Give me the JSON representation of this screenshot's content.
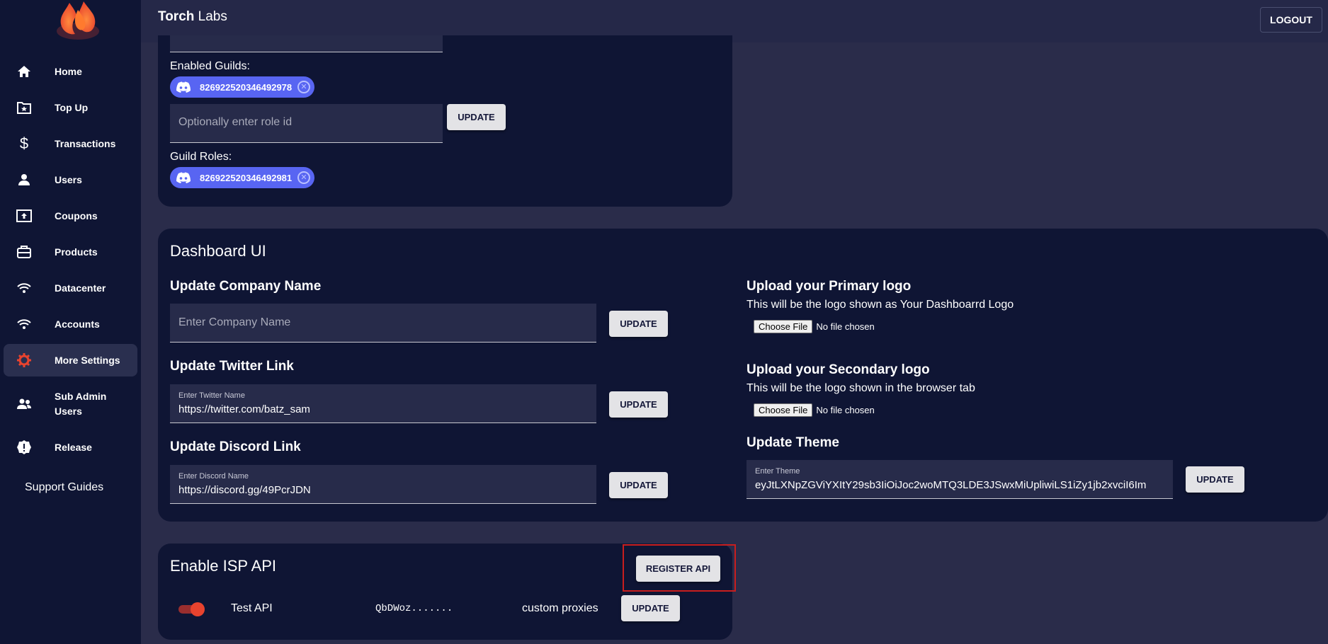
{
  "app": {
    "brand_bold": "Torch",
    "brand_rest": " Labs",
    "logout_label": "LOGOUT"
  },
  "colors": {
    "sidebar_bg": "#0f1534",
    "page_bg": "#2a2c4a",
    "accent": "#e8432e",
    "chip": "#5865f2",
    "highlight": "#c81e1e"
  },
  "sidebar": {
    "items": [
      {
        "label": "Home",
        "icon": "home-icon"
      },
      {
        "label": "Top Up",
        "icon": "folder-star-icon"
      },
      {
        "label": "Transactions",
        "icon": "dollar-icon"
      },
      {
        "label": "Users",
        "icon": "user-icon"
      },
      {
        "label": "Coupons",
        "icon": "upload-box-icon"
      },
      {
        "label": "Products",
        "icon": "briefcase-icon"
      },
      {
        "label": "Datacenter",
        "icon": "wifi-icon"
      },
      {
        "label": "Accounts",
        "icon": "wifi-icon"
      },
      {
        "label": "More Settings",
        "icon": "gear-icon",
        "active": true
      },
      {
        "label": "Sub Admin",
        "label2": "Users",
        "icon": "users-icon"
      },
      {
        "label": "Release",
        "icon": "alert-badge-icon"
      }
    ],
    "support": "Support Guides"
  },
  "guild_card": {
    "enabled_guilds_label": "Enabled Guilds:",
    "enabled_guild_id": "826922520346492978",
    "role_placeholder": "Optionally enter role id",
    "update_label": "UPDATE",
    "guild_roles_label": "Guild Roles:",
    "guild_role_id": "826922520346492981"
  },
  "dashboard_ui": {
    "title": "Dashboard UI",
    "company": {
      "heading": "Update Company Name",
      "placeholder": "Enter Company Name",
      "button": "UPDATE"
    },
    "twitter": {
      "heading": "Update Twitter Link",
      "field_label": "Enter Twitter Name",
      "value": "https://twitter.com/batz_sam",
      "button": "UPDATE"
    },
    "discord": {
      "heading": "Update Discord Link",
      "field_label": "Enter Discord Name",
      "value": "https://discord.gg/49PcrJDN",
      "button": "UPDATE"
    },
    "primary_logo": {
      "heading": "Upload your Primary logo",
      "desc": "This will be the logo shown as Your Dashboarrd Logo",
      "choose": "Choose File",
      "status": "No file chosen"
    },
    "secondary_logo": {
      "heading": "Upload your Secondary logo",
      "desc": "This will be the logo shown in the browser tab",
      "choose": "Choose File",
      "status": "No file chosen"
    },
    "theme": {
      "heading": "Update Theme",
      "field_label": "Enter Theme",
      "value": "eyJtLXNpZGViYXItY29sb3IiOiJoc2woMTQ3LDE3JSwxMiUpliwiLS1iZy1jb2xvciI6Im",
      "button": "UPDATE"
    }
  },
  "isp_api": {
    "title": "Enable ISP API",
    "register_button": "REGISTER API",
    "api_name": "Test API",
    "api_key": "QbDWoz.......",
    "proxy_type": "custom proxies",
    "update_button": "UPDATE"
  }
}
